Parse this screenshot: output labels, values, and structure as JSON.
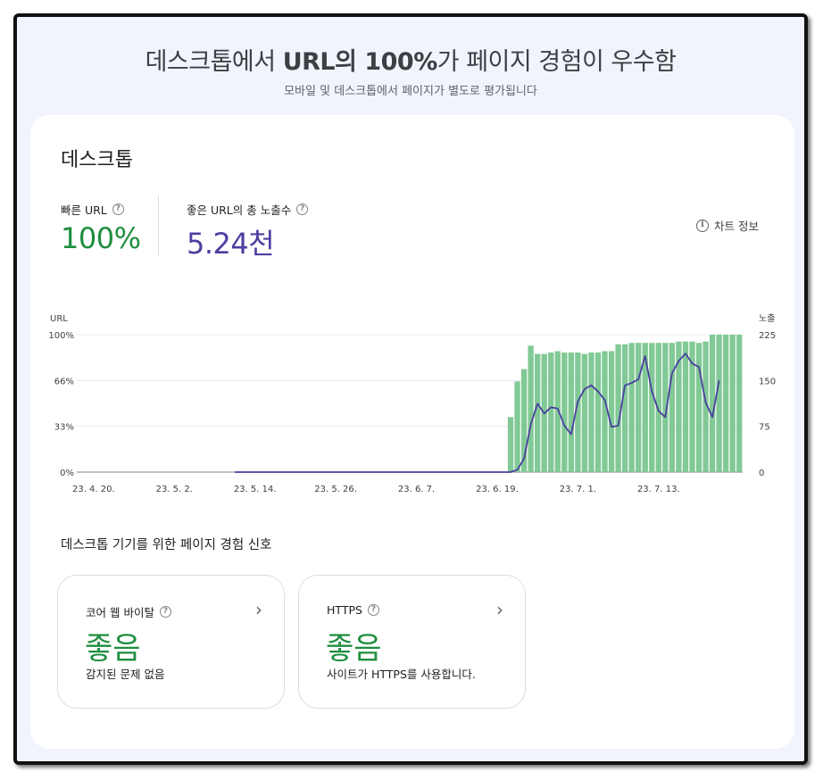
{
  "header": {
    "title_prefix": "데스크톱에서 ",
    "title_bold": "URL의 100%",
    "title_suffix": "가 페이지 경험이 우수함",
    "subtitle": "모바일 및 데스크톱에서 페이지가 별도로 평가됩니다"
  },
  "card": {
    "title": "데스크톱",
    "chart_info_label": "차트 정보"
  },
  "metrics": [
    {
      "label": "빠른 URL",
      "value": "100%"
    },
    {
      "label": "좋은 URL의 총 노출수",
      "value": "5.24천"
    }
  ],
  "signals": {
    "section_title": "데스크톱 기기를 위한 페이지 경험 신호",
    "items": [
      {
        "title": "코어 웹 바이탈",
        "status": "좋음",
        "description": "감지된 문제 없음"
      },
      {
        "title": "HTTPS",
        "status": "좋음",
        "description": "사이트가 HTTPS를 사용합니다."
      }
    ]
  },
  "colors": {
    "good_green": "#1e8e3e",
    "bar_green": "#81c995",
    "impressions_purple": "#4b3fa0"
  },
  "chart_data": {
    "type": "bar",
    "left_axis": {
      "label": "URL",
      "ticks": [
        "0%",
        "33%",
        "66%",
        "100%"
      ],
      "ylim": [
        0,
        100
      ]
    },
    "right_axis": {
      "label": "노출",
      "ticks": [
        "0",
        "75",
        "150",
        "225"
      ],
      "ylim": [
        0,
        225
      ]
    },
    "x_tick_labels": [
      "23. 4. 20.",
      "23. 5. 2.",
      "23. 5. 14.",
      "23. 5. 26.",
      "23. 6. 7.",
      "23. 6. 19.",
      "23. 7. 1.",
      "23. 7. 13."
    ],
    "days": 96,
    "series": [
      {
        "type": "bar",
        "axis": "left",
        "values": [
          0,
          0,
          0,
          0,
          0,
          0,
          0,
          0,
          0,
          0,
          0,
          0,
          0,
          0,
          0,
          0,
          0,
          0,
          0,
          0,
          0,
          0,
          0,
          0,
          0,
          0,
          0,
          0,
          0,
          0,
          0,
          0,
          0,
          0,
          0,
          0,
          0,
          0,
          0,
          0,
          0,
          0,
          0,
          0,
          0,
          0,
          0,
          0,
          0,
          0,
          0,
          0,
          0,
          0,
          0,
          0,
          0,
          0,
          0,
          0,
          0,
          0,
          0,
          0,
          40,
          66,
          75,
          92,
          86,
          86,
          87,
          88,
          87,
          87,
          87,
          86,
          87,
          87,
          88,
          88,
          93,
          93,
          94,
          94,
          94,
          94,
          94,
          94,
          94,
          95,
          95,
          95,
          94,
          95,
          100,
          100,
          100,
          100,
          100
        ]
      },
      {
        "type": "line",
        "axis": "right",
        "start_day": 23,
        "end_day": 90,
        "values": [
          0,
          0,
          0,
          0,
          0,
          0,
          0,
          0,
          0,
          0,
          0,
          0,
          0,
          0,
          0,
          0,
          0,
          0,
          0,
          0,
          0,
          0,
          0,
          0,
          0,
          0,
          0,
          0,
          0,
          0,
          0,
          0,
          0,
          0,
          0,
          0,
          0,
          0,
          0,
          0,
          0,
          0,
          4,
          22,
          78,
          112,
          96,
          106,
          104,
          76,
          62,
          116,
          136,
          142,
          132,
          118,
          74,
          76,
          142,
          146,
          152,
          190,
          132,
          100,
          90,
          162,
          182,
          194,
          178,
          172,
          114,
          90,
          150
        ]
      }
    ]
  }
}
